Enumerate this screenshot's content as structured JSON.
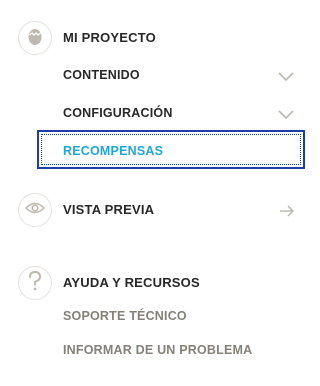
{
  "nav": {
    "project": {
      "label": "MI PROYECTO",
      "icon": "egg-icon",
      "items": [
        {
          "label": "CONTENIDO",
          "icon": "chevron-down-icon"
        },
        {
          "label": "CONFIGURACIÓN",
          "icon": "chevron-down-icon"
        },
        {
          "label": "RECOMPENSAS",
          "active": true
        }
      ]
    },
    "preview": {
      "label": "VISTA PREVIA",
      "icon": "eye-icon",
      "action_icon": "arrow-right-icon"
    },
    "help": {
      "label": "AYUDA Y RECURSOS",
      "icon": "question-icon",
      "items": [
        {
          "label": "SOPORTE TÉCNICO"
        },
        {
          "label": "INFORMAR DE UN PROBLEMA"
        }
      ]
    }
  },
  "colors": {
    "text": "#282828",
    "muted": "#85817a",
    "active": "#1fa8d6",
    "focus": "#1c3fa8",
    "icon": "#bdb8b0"
  }
}
